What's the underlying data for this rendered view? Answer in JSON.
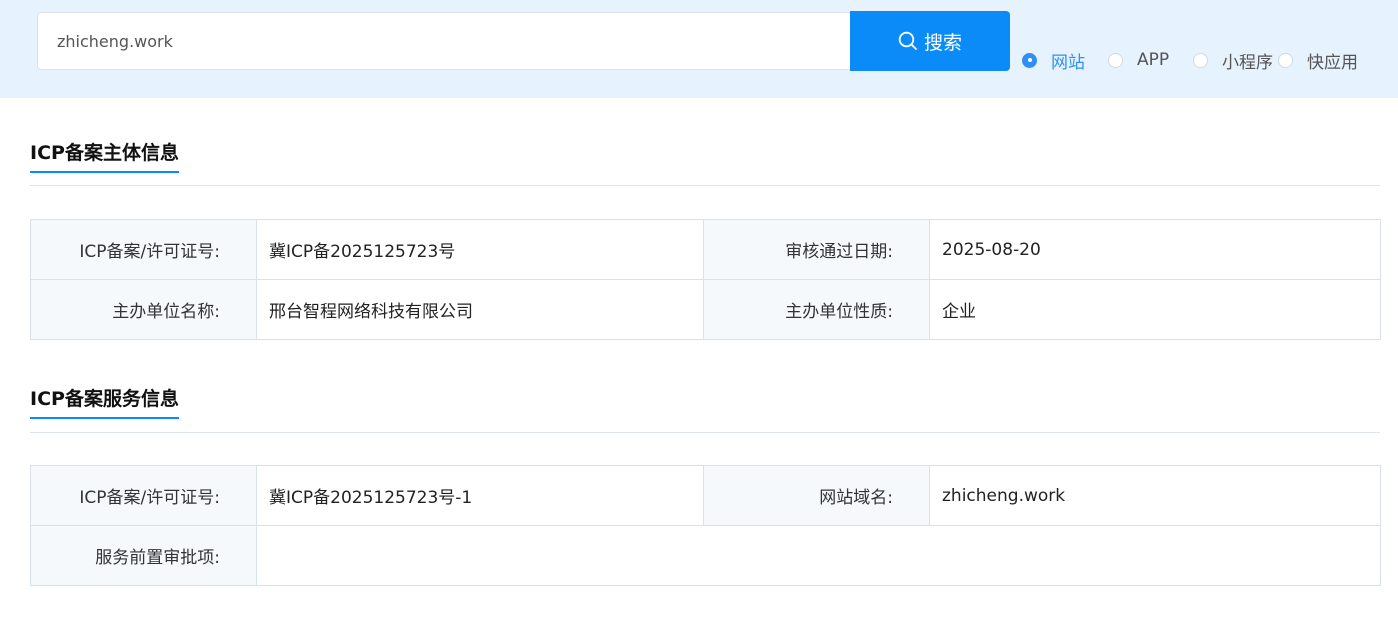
{
  "search": {
    "value": "zhicheng.work",
    "button_label": "搜索"
  },
  "radio_options": [
    {
      "label": "网站",
      "checked": true
    },
    {
      "label": "APP",
      "checked": false
    },
    {
      "label": "小程序",
      "checked": false
    },
    {
      "label": "快应用",
      "checked": false
    }
  ],
  "main_info": {
    "title": "ICP备案主体信息",
    "rows": [
      {
        "label1": "ICP备案/许可证号:",
        "value1": "冀ICP备2025125723号",
        "label2": "审核通过日期:",
        "value2": "2025-08-20"
      },
      {
        "label1": "主办单位名称:",
        "value1": "邢台智程网络科技有限公司",
        "label2": "主办单位性质:",
        "value2": "企业"
      }
    ]
  },
  "service_info": {
    "title": "ICP备案服务信息",
    "row1": {
      "label1": "ICP备案/许可证号:",
      "value1": "冀ICP备2025125723号-1",
      "label2": "网站域名:",
      "value2": "zhicheng.work"
    },
    "row2": {
      "label": "服务前置审批项:",
      "value": ""
    }
  },
  "colors": {
    "accent": "#0b8bf7",
    "topbar_bg": "#e6f2fd",
    "label_cell_bg": "#f5f9fc"
  }
}
